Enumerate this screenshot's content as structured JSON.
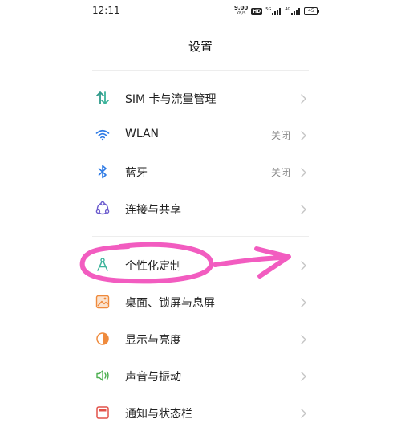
{
  "status_bar": {
    "time": "12:11",
    "net_speed_value": "9.00",
    "net_speed_unit": "KB/S",
    "hd_badge": "HD",
    "sim1_label": "5G",
    "sim2_label": "4G",
    "battery": "45"
  },
  "page_title": "设置",
  "groups": [
    {
      "items": [
        {
          "label": "SIM 卡与流量管理",
          "value": "",
          "icon": "sim-data-arrows-icon"
        },
        {
          "label": "WLAN",
          "value": "关闭",
          "icon": "wifi-icon"
        },
        {
          "label": "蓝牙",
          "value": "关闭",
          "icon": "bluetooth-icon"
        },
        {
          "label": "连接与共享",
          "value": "",
          "icon": "connection-share-icon"
        }
      ]
    },
    {
      "items": [
        {
          "label": "个性化定制",
          "value": "",
          "icon": "personalization-icon"
        },
        {
          "label": "桌面、锁屏与息屏",
          "value": "",
          "icon": "wallpaper-icon"
        },
        {
          "label": "显示与亮度",
          "value": "",
          "icon": "brightness-icon"
        },
        {
          "label": "声音与振动",
          "value": "",
          "icon": "sound-icon"
        },
        {
          "label": "通知与状态栏",
          "value": "",
          "icon": "notification-icon"
        }
      ]
    }
  ],
  "colors": {
    "accent_green": "#3bb39a",
    "icon_blue": "#2f7be5",
    "annotation_pink": "#f25cc0",
    "secondary_text": "#8a8a8a",
    "chevron": "#c4c4c4"
  }
}
